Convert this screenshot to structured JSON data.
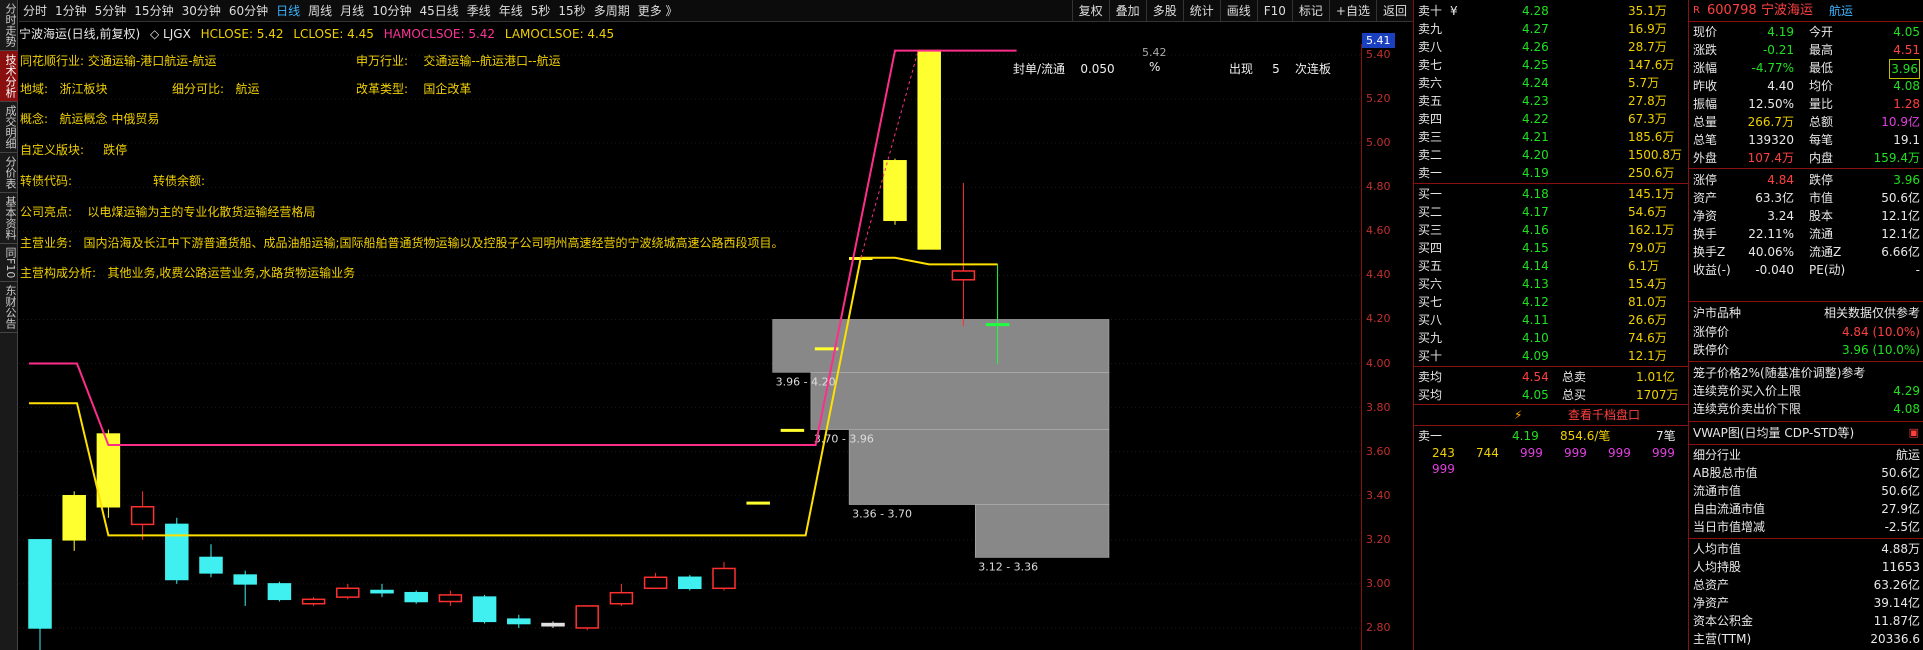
{
  "sidebar": [
    "分时走势",
    "技术分析",
    "成交明细",
    "分价表",
    "基本资料",
    "同F10",
    "东财公告"
  ],
  "sidebar_active": 1,
  "periods": [
    "分时",
    "1分钟",
    "5分钟",
    "15分钟",
    "30分钟",
    "60分钟",
    "日线",
    "周线",
    "月线",
    "10分钟",
    "45日线",
    "季线",
    "年线",
    "5秒",
    "15秒",
    "多周期",
    "更多 》"
  ],
  "period_selected": 6,
  "right_tools": [
    "复权",
    "叠加",
    "多股",
    "统计",
    "画线",
    "F10",
    "标记",
    "+自选",
    "返回"
  ],
  "indicator": {
    "name": "宁波海运(日线,前复权)",
    "sub": "◇ LJGX",
    "v1": "HCLOSE: 5.42",
    "v2": "LCLOSE: 4.45",
    "v3": "HAMOCLSOE: 5.42",
    "v4": "LAMOCLSOE: 4.45"
  },
  "info": {
    "ths_label": "同花顺行业:",
    "ths_value": "交通运输-港口航运-航运",
    "sw_label": "申万行业:",
    "sw_value": "交通运输--航运港口--航运",
    "region_label": "地域:",
    "region_value": "浙江板块",
    "sub_label": "细分可比:",
    "sub_value": "航运",
    "reform_label": "改革类型:",
    "reform_value": "国企改革",
    "concept_label": "概念:",
    "concept_value": "航运概念 中俄贸易",
    "custom_label": "自定义版块:",
    "custom_value": "跌停",
    "bond_label": "转债代码:",
    "bond_rest_label": "转债余额:",
    "highlight_label": "公司亮点:",
    "highlight_value": "以电煤运输为主的专业化散货运输经营格局",
    "main_label": "主营业务:",
    "main_value": "国内沿海及长江中下游普通货船、成品油船运输;国际船舶普通货物运输以及控股子公司明州高速经营的宁波绕城高速公路西段项目。",
    "comp_label": "主营构成分析:",
    "comp_value": "其他业务,收费公路运营业务,水路货物运输业务",
    "seal_label": "封单/流通",
    "seal_value": "0.050",
    "seal_pct": "%",
    "appear_label": "出现",
    "appear_value": "5",
    "appear_suffix": "次连板",
    "peak_label": "5.42"
  },
  "axis": {
    "current_price": "5.41",
    "ticks": [
      "5.40",
      "5.20",
      "5.00",
      "4.80",
      "4.60",
      "4.40",
      "4.20",
      "4.00",
      "3.80",
      "3.60",
      "3.40",
      "3.20",
      "3.00",
      "2.80"
    ]
  },
  "volume_profile": [
    {
      "range": "3.12 - 3.36",
      "volume": 0.35
    },
    {
      "range": "3.36 - 3.70",
      "volume": 0.68
    },
    {
      "range": "3.70 - 3.96",
      "volume": 0.78
    },
    {
      "range": "3.96 - 4.20",
      "volume": 0.88
    }
  ],
  "chart_data": {
    "type": "candlestick",
    "ylim": [
      2.7,
      5.45
    ],
    "hclose": 5.42,
    "lclose": 4.45,
    "candles": [
      {
        "o": 2.8,
        "c": 3.2,
        "h": 3.2,
        "l": 2.7
      },
      {
        "o": 3.2,
        "c": 3.4,
        "h": 3.42,
        "l": 3.15
      },
      {
        "o": 3.35,
        "c": 3.68,
        "h": 3.7,
        "l": 3.3
      },
      {
        "o": 3.35,
        "c": 3.27,
        "h": 3.42,
        "l": 3.2
      },
      {
        "o": 3.27,
        "c": 3.02,
        "h": 3.3,
        "l": 3.0
      },
      {
        "o": 3.05,
        "c": 3.12,
        "h": 3.18,
        "l": 3.03
      },
      {
        "o": 3.04,
        "c": 3.0,
        "h": 3.06,
        "l": 2.9
      },
      {
        "o": 3.0,
        "c": 2.93,
        "h": 3.01,
        "l": 2.92
      },
      {
        "o": 2.93,
        "c": 2.91,
        "h": 2.94,
        "l": 2.9
      },
      {
        "o": 2.94,
        "c": 2.98,
        "h": 3.0,
        "l": 2.93
      },
      {
        "o": 2.97,
        "c": 2.96,
        "h": 3.0,
        "l": 2.94
      },
      {
        "o": 2.96,
        "c": 2.92,
        "h": 2.97,
        "l": 2.91
      },
      {
        "o": 2.92,
        "c": 2.95,
        "h": 2.97,
        "l": 2.9
      },
      {
        "o": 2.94,
        "c": 2.83,
        "h": 2.95,
        "l": 2.82
      },
      {
        "o": 2.84,
        "c": 2.82,
        "h": 2.86,
        "l": 2.8
      },
      {
        "o": 2.82,
        "c": 2.81,
        "h": 2.83,
        "l": 2.8
      },
      {
        "o": 2.8,
        "c": 2.9,
        "h": 2.9,
        "l": 2.79
      },
      {
        "o": 2.91,
        "c": 2.96,
        "h": 3.0,
        "l": 2.9
      },
      {
        "o": 2.98,
        "c": 3.03,
        "h": 3.05,
        "l": 2.98
      },
      {
        "o": 3.03,
        "c": 2.98,
        "h": 3.04,
        "l": 2.97
      },
      {
        "o": 2.98,
        "c": 3.07,
        "h": 3.1,
        "l": 2.97
      },
      {
        "o": 3.37,
        "c": 3.37,
        "h": 3.37,
        "l": 3.37
      },
      {
        "o": 3.7,
        "c": 3.7,
        "h": 3.7,
        "l": 3.7
      },
      {
        "o": 4.07,
        "c": 4.07,
        "h": 4.07,
        "l": 4.07
      },
      {
        "o": 4.48,
        "c": 4.48,
        "h": 4.48,
        "l": 4.48
      },
      {
        "o": 4.65,
        "c": 4.92,
        "h": 4.93,
        "l": 4.63
      },
      {
        "o": 4.52,
        "c": 5.42,
        "h": 5.42,
        "l": 4.52
      },
      {
        "o": 4.42,
        "c": 4.38,
        "h": 4.82,
        "l": 4.17
      },
      {
        "o": 4.18,
        "c": 4.18,
        "h": 4.45,
        "l": 4.0
      }
    ],
    "down_color": [
      "c",
      "y",
      "y",
      "r",
      "c",
      "c",
      "c",
      "c",
      "r",
      "r",
      "c",
      "c",
      "r",
      "c",
      "c",
      "w",
      "r",
      "r",
      "r",
      "c",
      "r",
      "y",
      "y",
      "y",
      "y",
      "y",
      "y",
      "r",
      "g"
    ]
  },
  "orderbook": {
    "asks": [
      [
        "卖十",
        "4.28",
        "35.1万"
      ],
      [
        "卖九",
        "4.27",
        "16.9万"
      ],
      [
        "卖八",
        "4.26",
        "28.7万"
      ],
      [
        "卖七",
        "4.25",
        "147.6万"
      ],
      [
        "卖六",
        "4.24",
        "5.7万"
      ],
      [
        "卖五",
        "4.23",
        "27.8万"
      ],
      [
        "卖四",
        "4.22",
        "67.3万"
      ],
      [
        "卖三",
        "4.21",
        "185.6万"
      ],
      [
        "卖二",
        "4.20",
        "1500.8万"
      ],
      [
        "卖一",
        "4.19",
        "250.6万"
      ]
    ],
    "bids": [
      [
        "买一",
        "4.18",
        "145.1万"
      ],
      [
        "买二",
        "4.17",
        "54.6万"
      ],
      [
        "买三",
        "4.16",
        "162.1万"
      ],
      [
        "买四",
        "4.15",
        "79.0万"
      ],
      [
        "买五",
        "4.14",
        "6.1万"
      ],
      [
        "买六",
        "4.13",
        "15.4万"
      ],
      [
        "买七",
        "4.12",
        "81.0万"
      ],
      [
        "买八",
        "4.11",
        "26.6万"
      ],
      [
        "买九",
        "4.10",
        "74.6万"
      ],
      [
        "买十",
        "4.09",
        "12.1万"
      ]
    ],
    "ask_top_mark": "¥",
    "ask_avg_label": "卖均",
    "ask_avg": "4.54",
    "total_ask_label": "总卖",
    "total_ask": "1.01亿",
    "bid_avg_label": "买均",
    "bid_avg": "4.05",
    "total_bid_label": "总买",
    "total_bid": "1707万",
    "level_link": "查看千档盘口",
    "sell1_label": "卖一",
    "sell1_price": "4.19",
    "sell1_vol": "854.6/笔",
    "sell1_cnt": "7笔",
    "queue": [
      "243",
      "744",
      "999",
      "999",
      "999",
      "999",
      "999"
    ]
  },
  "quote": {
    "code": "600798",
    "name": "宁波海运",
    "industry": "航运",
    "r_mark": "R",
    "rows": [
      [
        "现价",
        "4.19",
        "今开",
        "4.05"
      ],
      [
        "涨跌",
        "-0.21",
        "最高",
        "4.51"
      ],
      [
        "涨幅",
        "-4.77%",
        "最低",
        "3.96"
      ],
      [
        "昨收",
        "4.40",
        "均价",
        "4.08"
      ],
      [
        "振幅",
        "12.50%",
        "量比",
        "1.28"
      ],
      [
        "总量",
        "266.7万",
        "总额",
        "10.9亿"
      ],
      [
        "总笔",
        "139320",
        "每笔",
        "19.1"
      ],
      [
        "外盘",
        "107.4万",
        "内盘",
        "159.4万"
      ],
      [
        "涨停",
        "4.84",
        "跌停",
        "3.96"
      ],
      [
        "资产",
        "63.3亿",
        "市值",
        "50.6亿"
      ],
      [
        "净资",
        "3.24",
        "股本",
        "12.1亿"
      ],
      [
        "换手",
        "22.11%",
        "流通",
        "12.1亿"
      ],
      [
        "换手Z",
        "40.06%",
        "流通Z",
        "6.66亿"
      ],
      [
        "收益(-)",
        "-0.040",
        "PE(动)",
        "-"
      ]
    ],
    "hs_label": "沪市品种",
    "hs_right": "相关数据仅供参考",
    "limit_up_label": "涨停价",
    "limit_up": "4.84 (10.0%)",
    "limit_down_label": "跌停价",
    "limit_down": "3.96 (10.0%)",
    "cage_title": "笼子价格2%(随基准价调整)参考",
    "cage_buy_label": "连续竞价买入价上限",
    "cage_buy": "4.29",
    "cage_sell_label": "连续竞价卖出价下限",
    "cage_sell": "4.08",
    "vwap_label": "VWAP图(日均量 CDP-STD等)",
    "ext": [
      [
        "细分行业",
        "航运"
      ],
      [
        "AB股总市值",
        "50.6亿"
      ],
      [
        "流通市值",
        "50.6亿"
      ],
      [
        "自由流通市值",
        "27.9亿"
      ],
      [
        "当日市值增减",
        "-2.5亿"
      ],
      [
        "人均市值",
        "4.88万"
      ],
      [
        "人均持股",
        "11653"
      ],
      [
        "总资产",
        "63.26亿"
      ],
      [
        "净资产",
        "39.14亿"
      ],
      [
        "资本公积金",
        "11.87亿"
      ],
      [
        "主营(TTM)",
        "20336.6"
      ]
    ]
  }
}
